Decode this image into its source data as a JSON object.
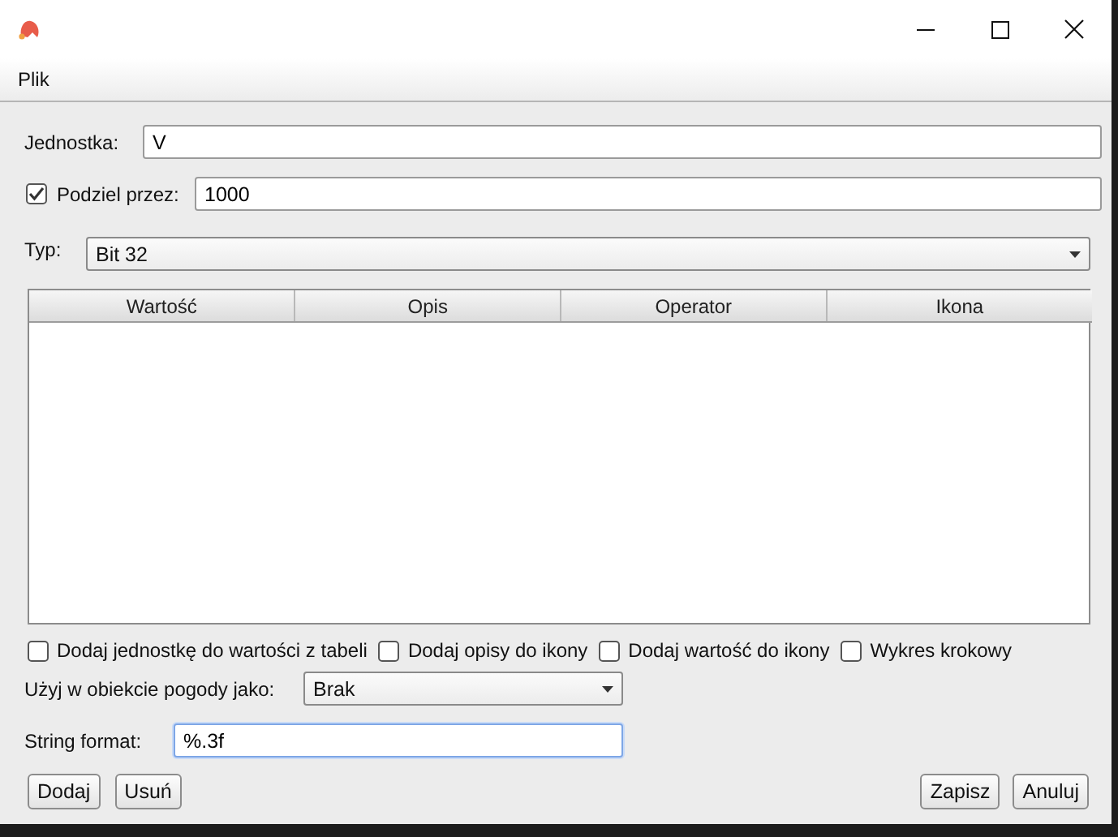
{
  "menu": [
    {
      "label": "Plik"
    }
  ],
  "unit": {
    "label": "Jednostka:",
    "value": "V"
  },
  "divide": {
    "label": "Podziel przez:",
    "checked": true,
    "value": "1000"
  },
  "type": {
    "label": "Typ:",
    "value": "Bit 32"
  },
  "table": {
    "columns": [
      "Wartość",
      "Opis",
      "Operator",
      "Ikona"
    ]
  },
  "options": [
    {
      "label": "Dodaj jednostkę do wartości z tabeli",
      "checked": false
    },
    {
      "label": "Dodaj opisy do ikony",
      "checked": false
    },
    {
      "label": "Dodaj wartość do ikony",
      "checked": false
    },
    {
      "label": "Wykres krokowy",
      "checked": false
    }
  ],
  "weather": {
    "label": "Użyj w obiekcie pogody jako:",
    "value": "Brak"
  },
  "string_format": {
    "label": "String format:",
    "value": "%.3f",
    "focused": true
  },
  "buttons_left": [
    "Dodaj",
    "Usuń"
  ],
  "buttons_right": [
    "Zapisz",
    "Anuluj"
  ]
}
